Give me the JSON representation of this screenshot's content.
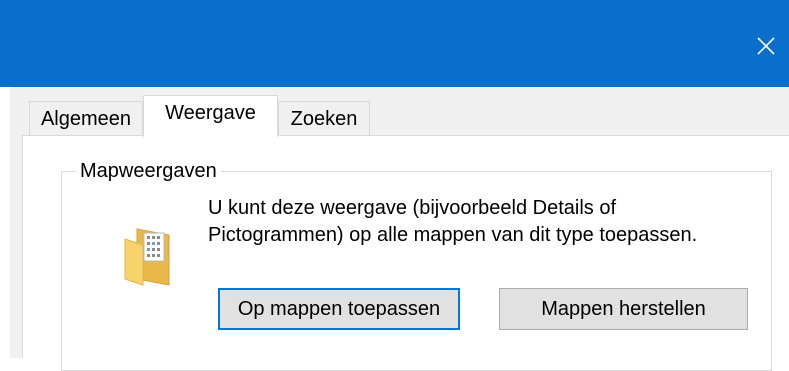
{
  "window": {
    "close_icon": "close-icon"
  },
  "tabs": [
    {
      "label": "Algemeen",
      "active": false
    },
    {
      "label": "Weergave",
      "active": true
    },
    {
      "label": "Zoeken",
      "active": false
    }
  ],
  "folder_views": {
    "title": "Mapweergaven",
    "icon": "folder-icon",
    "description": "U kunt deze weergave (bijvoorbeeld Details of Pictogrammen) op alle mappen van dit type toepassen.",
    "apply_button": "Op mappen toepassen",
    "reset_button": "Mappen herstellen"
  },
  "colors": {
    "titlebar": "#0a6fcb",
    "focus_border": "#0078d7",
    "folder": "#f6d36b"
  }
}
